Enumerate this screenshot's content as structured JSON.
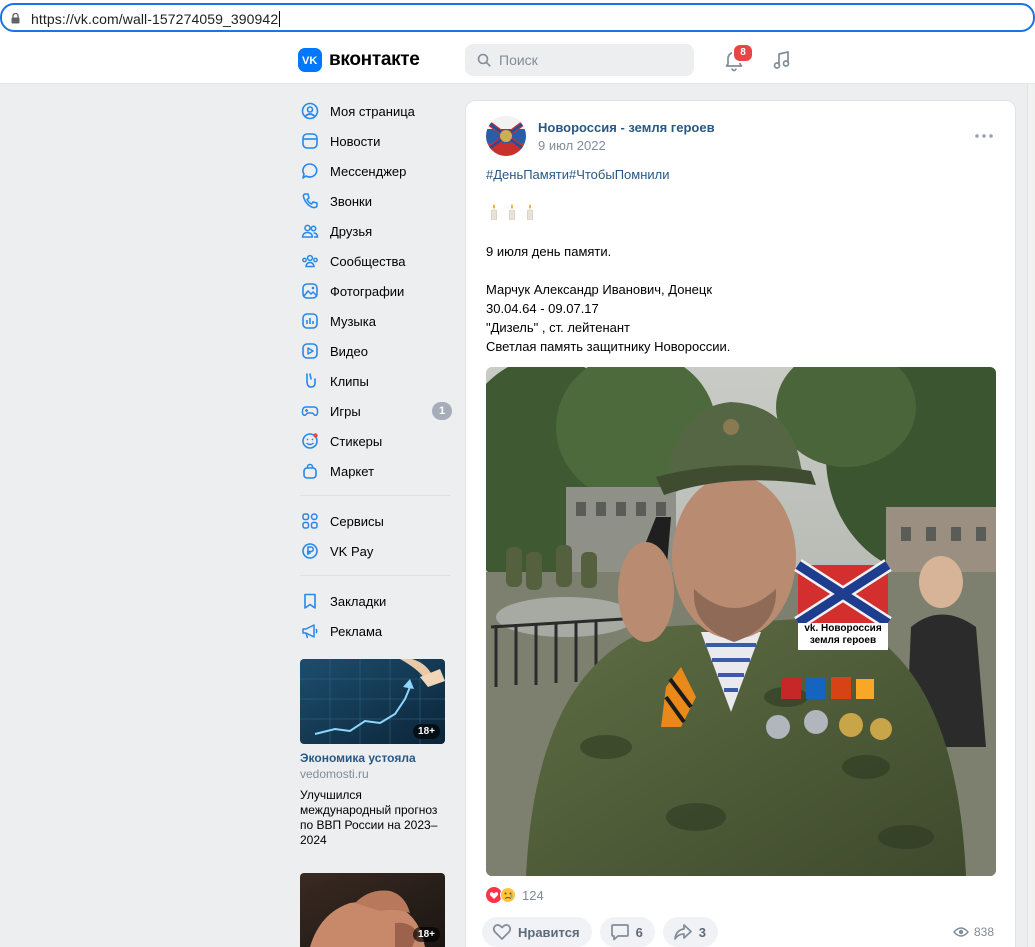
{
  "browser": {
    "url": "https://vk.com/wall-157274059_390942"
  },
  "header": {
    "logo_text": "вконтакте",
    "search_placeholder": "Поиск",
    "notifications_count": "8",
    "accent": "#0077ff"
  },
  "menu": {
    "items": [
      {
        "label": "Моя страница",
        "icon": "user-circle-icon"
      },
      {
        "label": "Новости",
        "icon": "newsfeed-icon"
      },
      {
        "label": "Мессенджер",
        "icon": "message-icon"
      },
      {
        "label": "Звонки",
        "icon": "phone-icon"
      },
      {
        "label": "Друзья",
        "icon": "friends-icon"
      },
      {
        "label": "Сообщества",
        "icon": "communities-icon"
      },
      {
        "label": "Фотографии",
        "icon": "photo-icon"
      },
      {
        "label": "Музыка",
        "icon": "music-icon"
      },
      {
        "label": "Видео",
        "icon": "video-icon"
      },
      {
        "label": "Клипы",
        "icon": "clips-icon"
      },
      {
        "label": "Игры",
        "icon": "game-icon",
        "count": "1"
      },
      {
        "label": "Стикеры",
        "icon": "sticker-icon"
      },
      {
        "label": "Маркет",
        "icon": "market-icon"
      }
    ],
    "items2": [
      {
        "label": "Сервисы",
        "icon": "services-icon"
      },
      {
        "label": "VK Pay",
        "icon": "vkpay-icon"
      }
    ],
    "items3": [
      {
        "label": "Закладки",
        "icon": "bookmark-icon"
      },
      {
        "label": "Реклама",
        "icon": "ads-icon"
      }
    ]
  },
  "ads": [
    {
      "age": "18+",
      "title": "Экономика устояла",
      "domain": "vedomosti.ru",
      "text": "Улучшился международный прогноз по ВВП России на 2023–2024"
    },
    {
      "age": "18+"
    }
  ],
  "post": {
    "author": "Новороссия - земля героев",
    "date": "9 июл 2022",
    "hashtags": "#ДеньПамяти#ЧтобыПомнили",
    "lines": [
      "9 июля день памяти.",
      "",
      "Марчук Александр Иванович, Донецк",
      "30.04.64 - 09.07.17",
      "\"Дизель\" , ст. лейтенант",
      "Светлая память защитнику Новороссии."
    ],
    "photo_caption_line1": "vk. Новороссия",
    "photo_caption_line2": "земля героев",
    "reactions_count": "124",
    "like_label": "Нравится",
    "comments_count": "6",
    "shares_count": "3",
    "views_count": "838"
  }
}
